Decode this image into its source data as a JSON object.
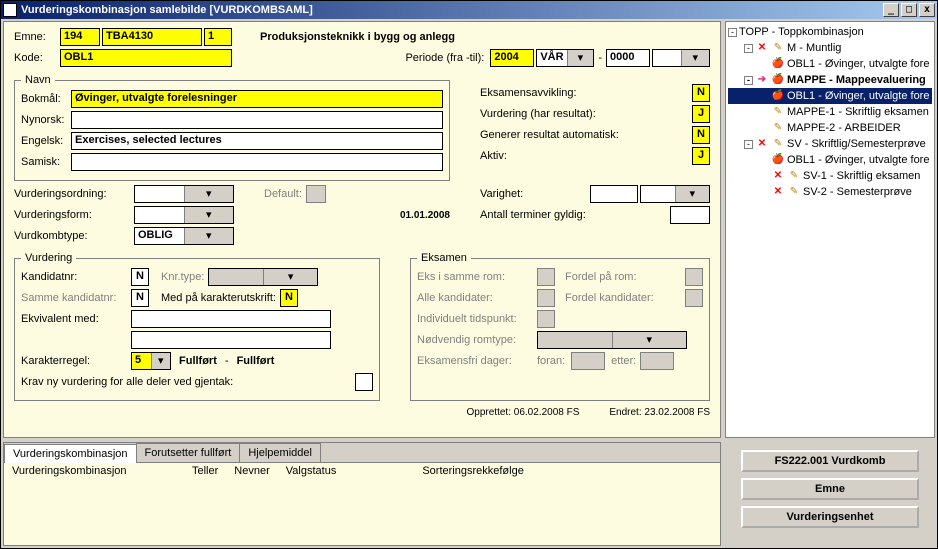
{
  "window_title": "Vurderingskombinasjon samlebilde   [VURDKOMBSAML]",
  "header": {
    "emne_lbl": "Emne:",
    "emne1": "194",
    "emne2": "TBA4130",
    "emne3": "1",
    "emne_title": "Produksjonsteknikk i bygg og anlegg",
    "kode_lbl": "Kode:",
    "kode": "OBL1",
    "periode_lbl": "Periode (fra -til):",
    "per1": "2004",
    "per2": "VÅR",
    "sep": "-",
    "per3": "0000"
  },
  "navn": {
    "legend": "Navn",
    "bokmal_lbl": "Bokmål:",
    "bokmal": "Øvinger, utvalgte forelesninger",
    "nynorsk_lbl": "Nynorsk:",
    "nynorsk": "",
    "engelsk_lbl": "Engelsk:",
    "engelsk": "Exercises, selected lectures",
    "samisk_lbl": "Samisk:",
    "samisk": ""
  },
  "right_flags": {
    "eksavv_lbl": "Eksamensavvikling:",
    "eksavv": "N",
    "vurdres_lbl": "Vurdering (har resultat):",
    "vurdres": "J",
    "genres_lbl": "Generer resultat automatisk:",
    "genres": "N",
    "aktiv_lbl": "Aktiv:",
    "aktiv": "J"
  },
  "mid": {
    "vurdord_lbl": "Vurderingsordning:",
    "default_lbl": "Default:",
    "vurdform_lbl": "Vurderingsform:",
    "vurdkombtype_lbl": "Vurdkombtype:",
    "vurdkombtype": "OBLIG",
    "datestamp": "01.01.2008",
    "varighet_lbl": "Varighet:",
    "antterm_lbl": "Antall terminer gyldig:"
  },
  "vurdering": {
    "legend": "Vurdering",
    "kandnr_lbl": "Kandidatnr:",
    "kandnr": "N",
    "knrtype_lbl": "Knr.type:",
    "sammekand_lbl": "Samme kandidatnr:",
    "sammekand": "N",
    "medkar_lbl": "Med på karakterutskrift:",
    "medkar": "N",
    "ekv_lbl": "Ekvivalent med:",
    "karregel_lbl": "Karakterregel:",
    "karregel": "5",
    "kar1": "Fullført",
    "kardash": "-",
    "kar2": "Fullført",
    "krav_lbl": "Krav ny vurdering for alle deler ved gjentak:"
  },
  "eksamen": {
    "legend": "Eksamen",
    "ekssamme_lbl": "Eks i samme rom:",
    "fordelrom_lbl": "Fordel på rom:",
    "allekand_lbl": "Alle kandidater:",
    "fordelkand_lbl": "Fordel kandidater:",
    "indtid_lbl": "Individuelt tidspunkt:",
    "nodrom_lbl": "Nødvendig romtype:",
    "eksfri_lbl": "Eksamensfri dager:",
    "foran_lbl": "foran:",
    "etter_lbl": "etter:"
  },
  "footer": {
    "opprettet": "Opprettet: 06.02.2008  FS",
    "endret": "Endret: 23.02.2008  FS"
  },
  "tree": [
    {
      "indent": 0,
      "pm": "-",
      "icons": [],
      "text": "TOPP - Toppkombinasjon",
      "bold": false
    },
    {
      "indent": 1,
      "pm": "-",
      "icons": [
        "redx",
        "pencil"
      ],
      "text": "M - Muntlig",
      "bold": false
    },
    {
      "indent": 2,
      "pm": "",
      "icons": [
        "apple"
      ],
      "text": "OBL1 - Øvinger, utvalgte fore",
      "bold": false
    },
    {
      "indent": 1,
      "pm": "-",
      "icons": [
        "arrowpink",
        "apple"
      ],
      "text": "MAPPE - Mappeevaluering",
      "bold": true
    },
    {
      "indent": 2,
      "pm": "",
      "icons": [
        "apple"
      ],
      "text": "OBL1 - Øvinger, utvalgte fore",
      "sel": true
    },
    {
      "indent": 2,
      "pm": "",
      "icons": [
        "pencil"
      ],
      "text": "MAPPE-1 - Skriftlig eksamen"
    },
    {
      "indent": 2,
      "pm": "",
      "icons": [
        "pencil"
      ],
      "text": "MAPPE-2 - ARBEIDER"
    },
    {
      "indent": 1,
      "pm": "-",
      "icons": [
        "redx",
        "pencil"
      ],
      "text": "SV - Skriftlig/Semesterprøve"
    },
    {
      "indent": 2,
      "pm": "",
      "icons": [
        "apple"
      ],
      "text": "OBL1 - Øvinger, utvalgte fore"
    },
    {
      "indent": 2,
      "pm": "",
      "icons": [
        "redx",
        "pencil"
      ],
      "text": "SV-1 - Skriftlig eksamen"
    },
    {
      "indent": 2,
      "pm": "",
      "icons": [
        "redx",
        "pencil"
      ],
      "text": "SV-2 - Semesterprøve"
    }
  ],
  "tabs": {
    "t1": "Vurderingskombinasjon",
    "t2": "Forutsetter fullført",
    "t3": "Hjelpemiddel",
    "c1": "Vurderingskombinasjon",
    "c2": "Teller",
    "c3": "Nevner",
    "c4": "Valgstatus",
    "c5": "Sorteringsrekkefølge"
  },
  "buttons": {
    "b1": "FS222.001 Vurdkomb",
    "b2": "Emne",
    "b3": "Vurderingsenhet"
  }
}
